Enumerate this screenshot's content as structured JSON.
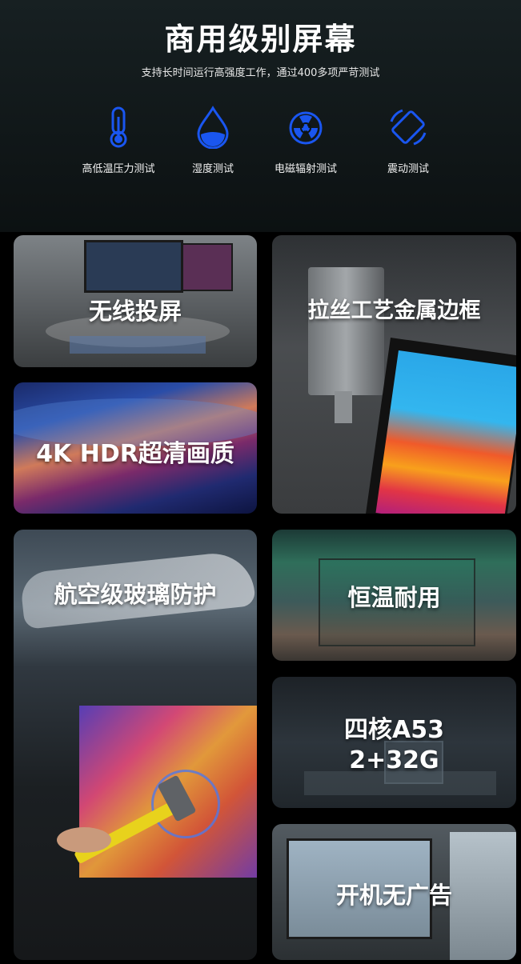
{
  "header": {
    "title": "商用级别屏幕",
    "subtitle": "支持长时间运行高强度工作，通过400多项严苛测试"
  },
  "features": [
    {
      "label": "高低温压力测试",
      "icon": "thermometer-icon"
    },
    {
      "label": "湿度测试",
      "icon": "water-drop-icon"
    },
    {
      "label": "电磁辐射测试",
      "icon": "radiation-icon"
    },
    {
      "label": "震动测试",
      "icon": "vibration-icon"
    }
  ],
  "cards": {
    "wireless": "无线投屏",
    "frame": "拉丝工艺金属边框",
    "hdr": "4K HDR超清画质",
    "glass": "航空级玻璃防护",
    "temp": "恒温耐用",
    "cpu_line1": "四核A53",
    "cpu_line2": "2+32G",
    "noads": "开机无广告"
  },
  "colors": {
    "accent": "#1a56f0",
    "background": "#000000"
  }
}
